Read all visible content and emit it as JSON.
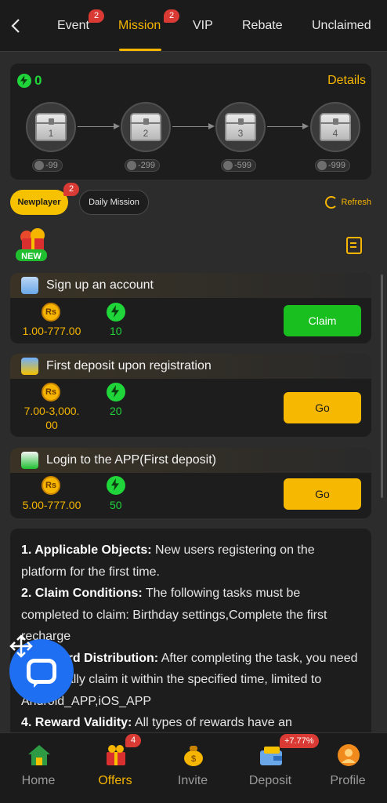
{
  "header": {
    "tabs": [
      {
        "label": "Event",
        "badge": "2"
      },
      {
        "label": "Mission",
        "badge": "2",
        "active": true
      },
      {
        "label": "VIP"
      },
      {
        "label": "Rebate"
      },
      {
        "label": "Unclaimed"
      }
    ]
  },
  "progress": {
    "points": "0",
    "details_label": "Details",
    "chests": [
      {
        "number": "1",
        "cost": "-99"
      },
      {
        "number": "2",
        "cost": "-299"
      },
      {
        "number": "3",
        "cost": "-599"
      },
      {
        "number": "4",
        "cost": "-999"
      }
    ]
  },
  "mission_types": {
    "active": "Newplayer",
    "active_badge": "2",
    "other": "Daily Mission",
    "refresh_label": "Refresh"
  },
  "new_label": "NEW",
  "tasks": [
    {
      "title": "Sign up an account",
      "coin_label": "Rs",
      "amount": "1.00-777.00",
      "points": "10",
      "button": "Claim"
    },
    {
      "title": "First deposit upon registration",
      "coin_label": "Rs",
      "amount_line1": "7.00-3,000.",
      "amount_line2": "00",
      "points": "20",
      "button": "Go"
    },
    {
      "title": "Login to the APP(First deposit)",
      "coin_label": "Rs",
      "amount": "5.00-777.00",
      "points": "50",
      "button": "Go"
    }
  ],
  "rules": [
    {
      "heading": "1. Applicable Objects:",
      "text": " New users registering on the platform for the first time."
    },
    {
      "heading": "2. Claim Conditions:",
      "text": " The following tasks must be completed to claim: Birthday settings,Complete the first recharge"
    },
    {
      "heading": "3. Reward Distribution:",
      "text": " After completing the task, you need to manually claim it within the specified time, limited to Android_APP,iOS_APP"
    },
    {
      "heading": "4. Reward Validity:",
      "text": " All types of rewards have an"
    }
  ],
  "bottom_nav": [
    {
      "label": "Home"
    },
    {
      "label": "Offers",
      "badge": "4",
      "active": true
    },
    {
      "label": "Invite"
    },
    {
      "label": "Deposit",
      "badge": "+7.77%"
    },
    {
      "label": "Profile"
    }
  ],
  "colors": {
    "accent": "#f6b500",
    "green": "#1fd53a",
    "claim": "#19bf1f",
    "badge": "#d93a33",
    "chat": "#1f6ff2"
  }
}
